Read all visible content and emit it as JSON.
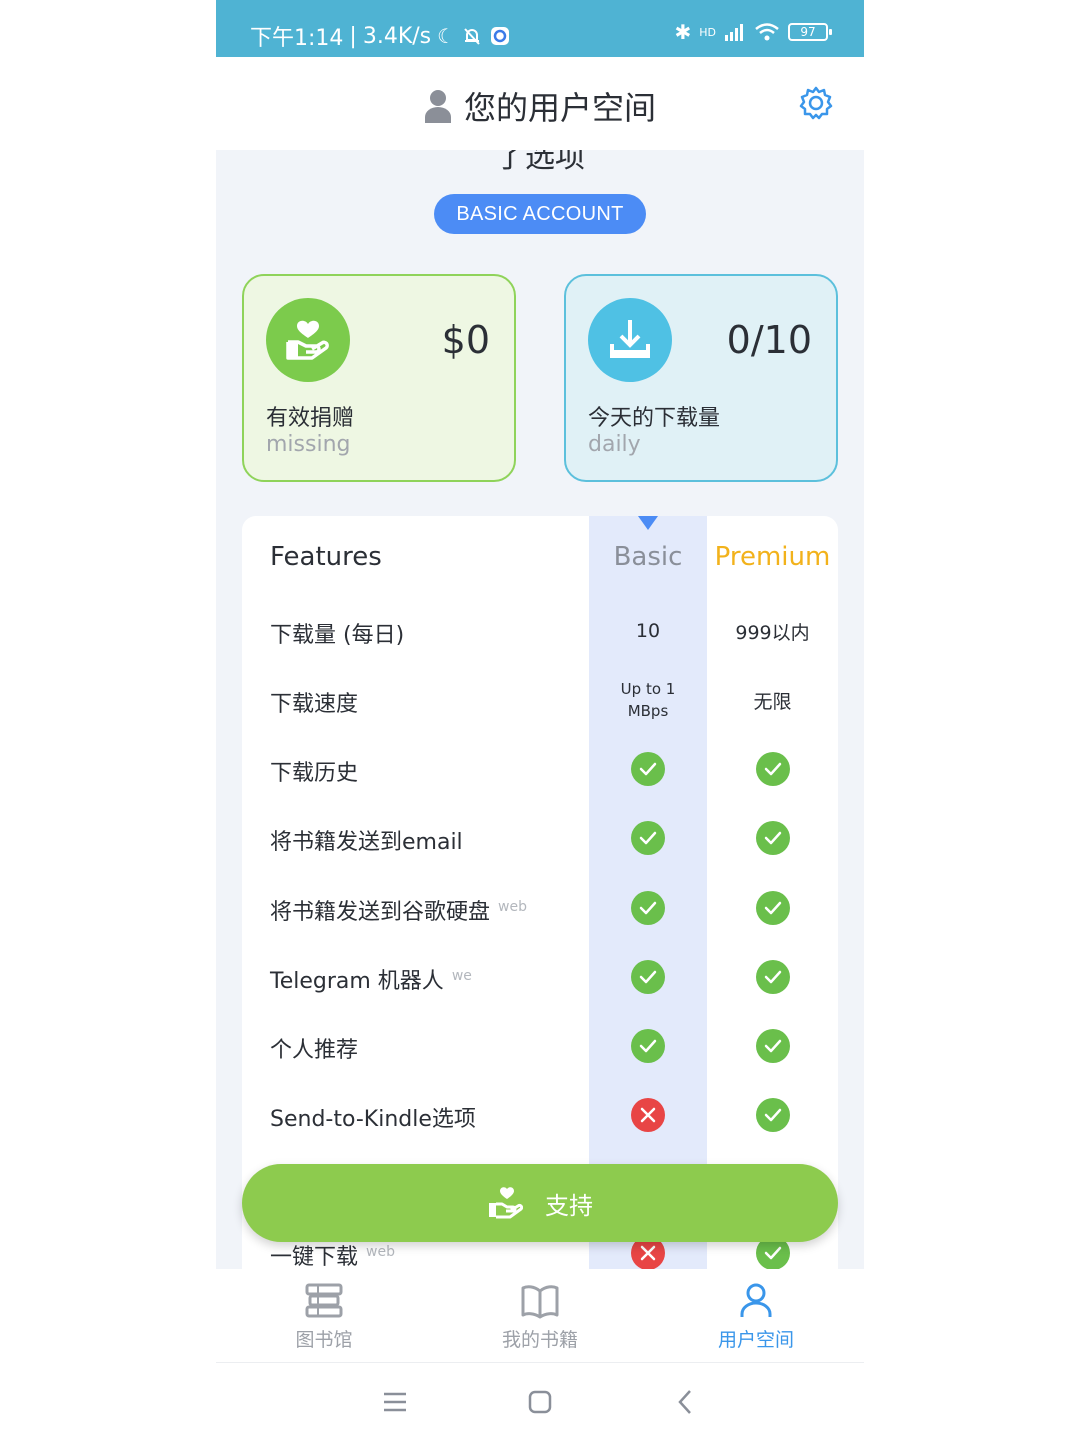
{
  "status_bar": {
    "time": "下午1:14",
    "speed": "3.4K/s",
    "battery": "97",
    "network": "HD"
  },
  "header": {
    "title": "您的用户空间",
    "settings_icon": "gear-icon",
    "user_icon": "user-icon"
  },
  "account": {
    "cut_text": "了选项",
    "badge": "BASIC ACCOUNT"
  },
  "stats": {
    "donation": {
      "value": "$0",
      "label": "有效捐赠",
      "sub": "missing",
      "icon": "donate-hand-heart-icon"
    },
    "downloads": {
      "value": "0/10",
      "label": "今天的下载量",
      "sub": "daily",
      "icon": "download-icon"
    }
  },
  "features": {
    "header": "Features",
    "basic": "Basic",
    "premium": "Premium",
    "rows": [
      {
        "label": "下载量 (每日)",
        "tag": "",
        "basic": "10",
        "premium": "999以内"
      },
      {
        "label": "下载速度",
        "tag": "",
        "basic": "Up to 1\nMBps",
        "premium": "无限"
      },
      {
        "label": "下载历史",
        "tag": "",
        "basic": "yes",
        "premium": "yes"
      },
      {
        "label": "将书籍发送到email",
        "tag": "",
        "basic": "yes",
        "premium": "yes"
      },
      {
        "label": "将书籍发送到谷歌硬盘",
        "tag": "web",
        "basic": "yes",
        "premium": "yes"
      },
      {
        "label": "Telegram 机器人",
        "tag": "we",
        "basic": "yes",
        "premium": "yes"
      },
      {
        "label": "个人推荐",
        "tag": "",
        "basic": "yes",
        "premium": "yes"
      },
      {
        "label": "Send-to-Kindle选项",
        "tag": "",
        "basic": "no",
        "premium": "yes"
      },
      {
        "label": "一键下载",
        "tag": "web",
        "basic": "no",
        "premium": "yes"
      }
    ]
  },
  "support_button": {
    "label": "支持",
    "icon": "donate-hand-heart-icon"
  },
  "bottom_nav": {
    "items": [
      {
        "label": "图书馆",
        "icon": "library-icon",
        "active": false
      },
      {
        "label": "我的书籍",
        "icon": "open-book-icon",
        "active": false
      },
      {
        "label": "用户空间",
        "icon": "user-icon",
        "active": true
      }
    ]
  },
  "colors": {
    "status_bar": "#4fb3d3",
    "accent_blue": "#4c8cf5",
    "premium_gold": "#f2b21b",
    "check_green": "#6abf4b",
    "cross_red": "#e84545",
    "support_green": "#8dcb4e"
  }
}
